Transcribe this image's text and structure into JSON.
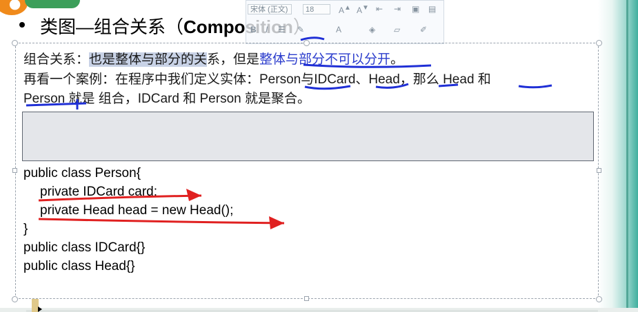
{
  "slide": {
    "title_cn": "类图—组合关系（",
    "title_en": "Composition",
    "title_close": "）"
  },
  "mini_toolbar": {
    "font_name": "宋体 (正文)",
    "font_size": "18"
  },
  "text": {
    "line1": {
      "prefix": "组合关系：",
      "highlight": "也是整体与部分的关",
      "mid": "系，但是",
      "blue": "整体与部分不可以分开",
      "end": "。"
    },
    "line2": "再看一个案例：在程序中我们定义实体：Person与IDCard、Head，那么 Head 和",
    "line3": "Person 就是 组合，IDCard 和 Person 就是聚合。"
  },
  "code": {
    "lines": [
      "public class Person{",
      "    private IDCard card;",
      "    private Head head = new Head();",
      "}",
      "public class IDCard{}",
      "public class Head{}"
    ]
  },
  "colors": {
    "annotation_blue": "#1f2fd6",
    "annotation_red": "#e02020",
    "teal": "#3faf9e"
  }
}
